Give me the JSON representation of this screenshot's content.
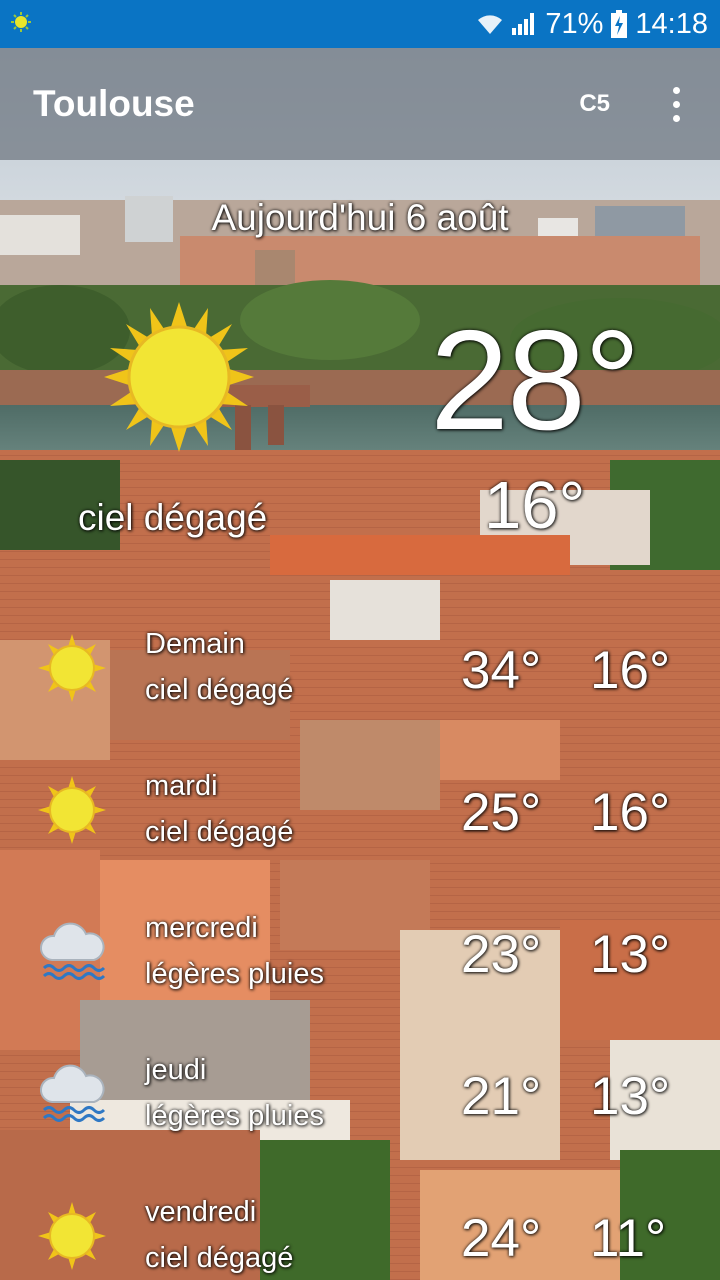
{
  "status_bar": {
    "battery": "71%",
    "time": "14:18",
    "icons": [
      "app-notification-icon",
      "wifi-icon",
      "signal-icon",
      "battery-charging-icon"
    ]
  },
  "app_bar": {
    "title": "Toulouse",
    "unit_button": "C5",
    "overflow_icon": "more-vert-icon"
  },
  "today": {
    "date": "Aujourd'hui 6 août",
    "temp": "28°",
    "low": "16°",
    "description": "ciel dégagé",
    "icon": "sun-icon"
  },
  "forecast": [
    {
      "day": "Demain",
      "description": "ciel dégagé",
      "high": "34°",
      "low": "16°",
      "icon": "sun-icon"
    },
    {
      "day": "mardi",
      "description": "ciel dégagé",
      "high": "25°",
      "low": "16°",
      "icon": "sun-icon"
    },
    {
      "day": "mercredi",
      "description": "légères pluies",
      "high": "23°",
      "low": "13°",
      "icon": "rain-cloud-icon"
    },
    {
      "day": "jeudi",
      "description": "légères pluies",
      "high": "21°",
      "low": "13°",
      "icon": "rain-cloud-icon"
    },
    {
      "day": "vendredi",
      "description": "ciel dégagé",
      "high": "24°",
      "low": "11°",
      "icon": "sun-icon"
    }
  ],
  "colors": {
    "status_bar": "#0a74c4",
    "sun": "#f2e534",
    "sun_rays": "#f0c419",
    "rain": "#2f78c4"
  }
}
